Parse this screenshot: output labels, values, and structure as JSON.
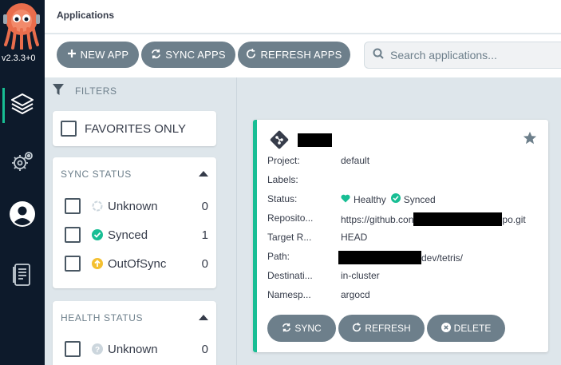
{
  "nav": {
    "version": "v2.3.3+0",
    "items": [
      {
        "name": "applications",
        "icon": "layers-icon"
      },
      {
        "name": "settings",
        "icon": "gears-icon"
      },
      {
        "name": "user-info",
        "icon": "user-icon"
      },
      {
        "name": "documentation",
        "icon": "docs-icon"
      }
    ]
  },
  "topbar": {
    "title": "Applications"
  },
  "toolbar": {
    "new_app": "NEW APP",
    "sync_apps": "SYNC APPS",
    "refresh_apps": "REFRESH APPS",
    "search_placeholder": "Search applications..."
  },
  "filters": {
    "header": "FILTERS",
    "favorites": "FAVORITES ONLY",
    "sync_status": {
      "title": "SYNC STATUS",
      "items": [
        {
          "label": "Unknown",
          "count": "0",
          "icon": "circle-outline-icon"
        },
        {
          "label": "Synced",
          "count": "1",
          "icon": "check-circle-icon"
        },
        {
          "label": "OutOfSync",
          "count": "0",
          "icon": "arrow-up-circle-icon"
        }
      ]
    },
    "health_status": {
      "title": "HEALTH STATUS",
      "items": [
        {
          "label": "Unknown",
          "count": "0",
          "icon": "question-circle-icon"
        }
      ]
    }
  },
  "app": {
    "fields": [
      {
        "key": "Project:",
        "value": "default"
      },
      {
        "key": "Labels:",
        "value": ""
      },
      {
        "key": "Status:",
        "health": "Healthy",
        "sync": "Synced"
      },
      {
        "key": "Reposito...",
        "value_prefix": "https://github.con",
        "value_suffix": "po.git"
      },
      {
        "key": "Target R...",
        "value": "HEAD"
      },
      {
        "key": "Path:",
        "value_suffix": "dev/tetris/"
      },
      {
        "key": "Destinati...",
        "value": "in-cluster"
      },
      {
        "key": "Namesp...",
        "value": "argocd"
      }
    ],
    "actions": {
      "sync": "SYNC",
      "refresh": "REFRESH",
      "delete": "DELETE"
    }
  },
  "colors": {
    "nav_bg": "#0d1a2b",
    "accent": "#18be94",
    "button": "#6d7f8b",
    "out_of_sync": "#f4c030"
  }
}
